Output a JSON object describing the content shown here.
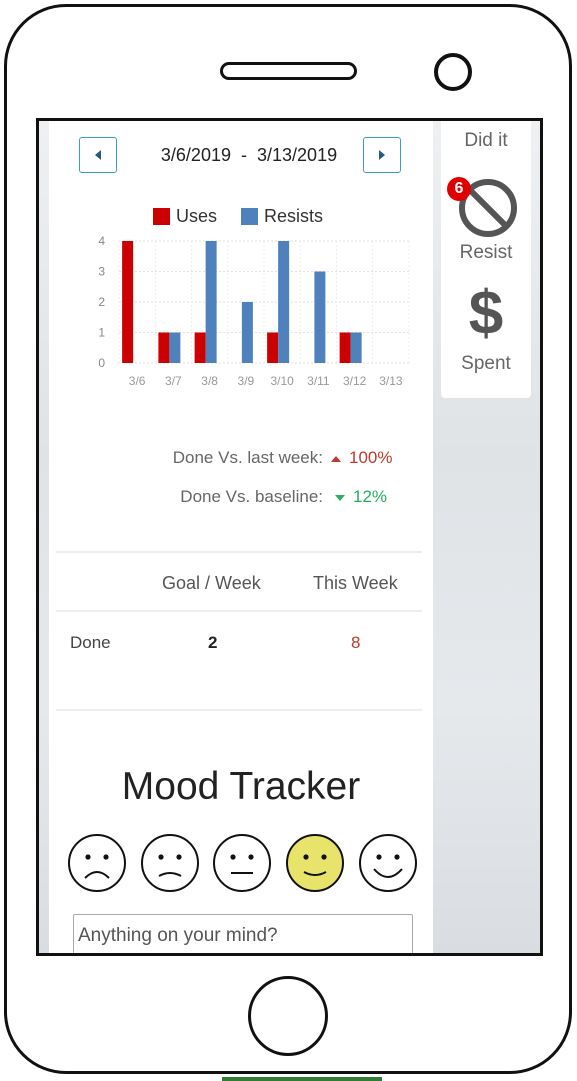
{
  "date_nav": {
    "start": "3/6/2019",
    "separator": "-",
    "end": "3/13/2019"
  },
  "chart_data": {
    "type": "bar",
    "categories": [
      "3/6",
      "3/7",
      "3/8",
      "3/9",
      "3/10",
      "3/11",
      "3/12",
      "3/13"
    ],
    "series": [
      {
        "name": "Uses",
        "values": [
          4,
          1,
          1,
          0,
          1,
          0,
          1,
          0
        ],
        "color": "#cc0000"
      },
      {
        "name": "Resists",
        "values": [
          0,
          1,
          4,
          2,
          4,
          3,
          1,
          0
        ],
        "color": "#4f81bd"
      }
    ],
    "ylim": [
      0,
      4
    ],
    "yticks": [
      "0",
      "1",
      "2",
      "3",
      "4"
    ],
    "grid": true,
    "legend": "top"
  },
  "comparisons": [
    {
      "label": "Done Vs. last week:",
      "value": "100%",
      "direction": "up",
      "color": "#c0392b"
    },
    {
      "label": "Done Vs. baseline:",
      "value": "12%",
      "direction": "down",
      "color": "#27ae60"
    }
  ],
  "goal_table": {
    "headers": [
      "Goal / Week",
      "This Week"
    ],
    "rows": [
      {
        "label": "Done",
        "goal": "2",
        "this_week": "8"
      }
    ],
    "this_week_color": "#c0392b"
  },
  "mood": {
    "title": "Mood Tracker",
    "faces": [
      "very-sad-face-icon",
      "sad-face-icon",
      "neutral-face-icon",
      "content-face-icon",
      "happy-face-icon"
    ],
    "selected_index": 3,
    "selected_color": "#e8e36a",
    "input_placeholder": "Anything on your mind?"
  },
  "side_actions": {
    "did_it_label": "Did it",
    "resist_label": "Resist",
    "resist_badge": "6",
    "spent_label": "Spent",
    "spent_symbol": "$"
  }
}
